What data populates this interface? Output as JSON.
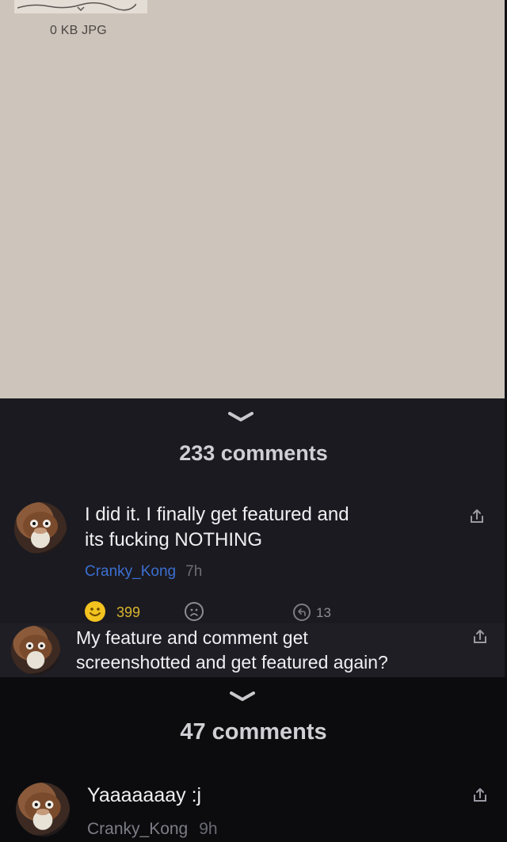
{
  "post_image": {
    "meta": "0 KB JPG"
  },
  "thread1": {
    "count": "233 comments",
    "comment": {
      "text_line1": "I did it. I finally get featured and",
      "text_line2": "its fucking NOTHING",
      "author": "Cranky_Kong",
      "time": "7h",
      "likes": "399",
      "replies": "13"
    }
  },
  "thread1_next": {
    "text_line1": "My feature and comment get",
    "text_line2": "screenshotted and get featured again?"
  },
  "thread2": {
    "count": "47 comments",
    "comment": {
      "text": "Yaaaaaaay :j",
      "author": "Cranky_Kong",
      "time": "9h"
    }
  },
  "colors": {
    "image_bg": "#cdc4bb",
    "panel_bg": "#1b1a20",
    "author_link": "#3b6fd0",
    "like_yellow": "#f3c320"
  },
  "icons": [
    "chevron-down-icon",
    "share-icon",
    "laugh-emoji-icon",
    "frown-icon",
    "reply-icon"
  ]
}
